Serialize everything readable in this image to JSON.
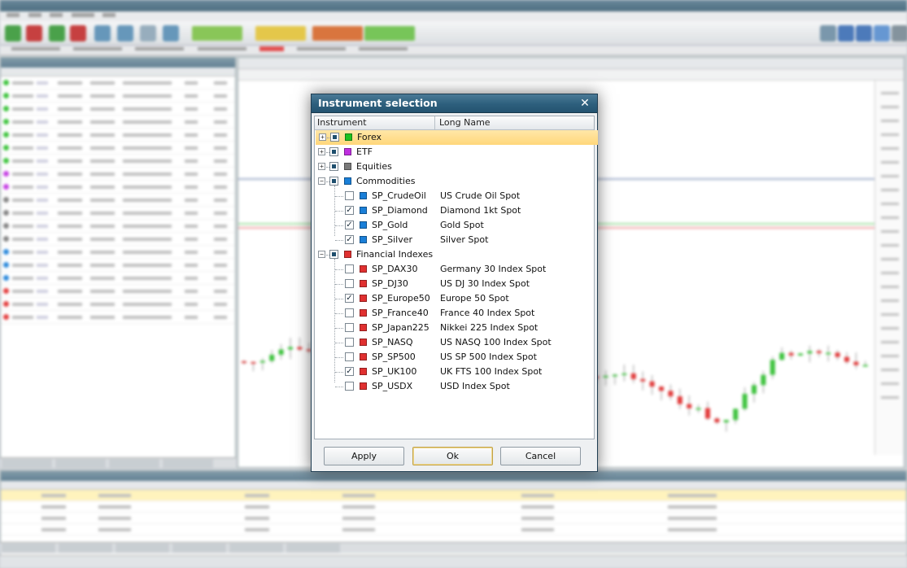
{
  "dialog": {
    "title": "Instrument selection",
    "close_glyph": "✕",
    "columns": {
      "instrument": "Instrument",
      "long_name": "Long Name"
    },
    "groups": [
      {
        "name": "Forex",
        "color": "#1fc21f",
        "expanded": false,
        "selected": true,
        "items": []
      },
      {
        "name": "ETF",
        "color": "#c030e0",
        "expanded": false,
        "selected": false,
        "items": []
      },
      {
        "name": "Equities",
        "color": "#7a7a7a",
        "expanded": false,
        "selected": false,
        "items": []
      },
      {
        "name": "Commodities",
        "color": "#1a7fd8",
        "expanded": true,
        "selected": false,
        "items": [
          {
            "name": "SP_CrudeOil",
            "long": "US Crude Oil Spot",
            "checked": false
          },
          {
            "name": "SP_Diamond",
            "long": "Diamond 1kt Spot",
            "checked": true
          },
          {
            "name": "SP_Gold",
            "long": "Gold Spot",
            "checked": true
          },
          {
            "name": "SP_Silver",
            "long": "Silver Spot",
            "checked": true
          }
        ]
      },
      {
        "name": "Financial Indexes",
        "color": "#e03030",
        "expanded": true,
        "selected": false,
        "items": [
          {
            "name": "SP_DAX30",
            "long": "Germany 30 Index Spot",
            "checked": false
          },
          {
            "name": "SP_DJ30",
            "long": "US DJ 30 Index Spot",
            "checked": false
          },
          {
            "name": "SP_Europe50",
            "long": "Europe 50 Spot",
            "checked": true
          },
          {
            "name": "SP_France40",
            "long": "France 40 Index Spot",
            "checked": false
          },
          {
            "name": "SP_Japan225",
            "long": "Nikkei 225 Index Spot",
            "checked": false
          },
          {
            "name": "SP_NASQ",
            "long": "US NASQ 100 Index Spot",
            "checked": false
          },
          {
            "name": "SP_SP500",
            "long": "US SP 500 Index Spot",
            "checked": false
          },
          {
            "name": "SP_UK100",
            "long": "UK FTS 100 Index Spot",
            "checked": true
          },
          {
            "name": "SP_USDX",
            "long": "USD Index Spot",
            "checked": false
          }
        ]
      }
    ],
    "buttons": {
      "apply": "Apply",
      "ok": "Ok",
      "cancel": "Cancel"
    }
  },
  "colors": {
    "accent": "#2d5f7d",
    "selection": "#ffd77a",
    "bull": "#2fbf2f",
    "bear": "#e02a2a"
  },
  "icons": {
    "check": "✓",
    "expand": "+",
    "collapse": "−"
  }
}
